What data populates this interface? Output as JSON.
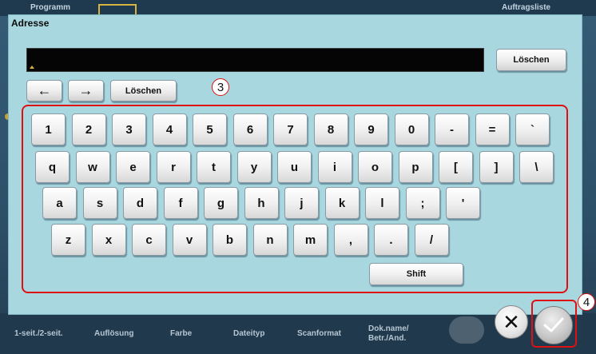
{
  "background": {
    "top_tabs": [
      "Programm",
      "Auftragsliste"
    ],
    "bottom_items": [
      "1-seit./2-seit.",
      "Auflösung",
      "Farbe",
      "Dateityp",
      "Scanformat",
      "Dok.name/\nBetr./And."
    ]
  },
  "dialog": {
    "title": "Adresse",
    "address_value": "",
    "clear_top_label": "Löschen",
    "cursor_left_icon": "arrow-left-icon",
    "cursor_right_icon": "arrow-right-icon",
    "left_arrow": "←",
    "right_arrow": "→",
    "clear_small_label": "Löschen"
  },
  "keyboard": {
    "row1": [
      "1",
      "2",
      "3",
      "4",
      "5",
      "6",
      "7",
      "8",
      "9",
      "0",
      "-",
      "=",
      "`"
    ],
    "row2": [
      "q",
      "w",
      "e",
      "r",
      "t",
      "y",
      "u",
      "i",
      "o",
      "p",
      "[",
      "]",
      "\\"
    ],
    "row3": [
      "a",
      "s",
      "d",
      "f",
      "g",
      "h",
      "j",
      "k",
      "l",
      ";",
      "'"
    ],
    "row4": [
      "z",
      "x",
      "c",
      "v",
      "b",
      "n",
      "m",
      ",",
      ".",
      "/"
    ],
    "shift_label": "Shift"
  },
  "callouts": {
    "keyboard": "3",
    "ok": "4"
  },
  "controls": {
    "close_icon": "close-icon",
    "close_symbol": "✕",
    "ok_icon": "checkmark-icon"
  },
  "colors": {
    "dialog_bg": "#a8d7e0",
    "highlight": "#dd1111",
    "field_bg": "#050505"
  }
}
